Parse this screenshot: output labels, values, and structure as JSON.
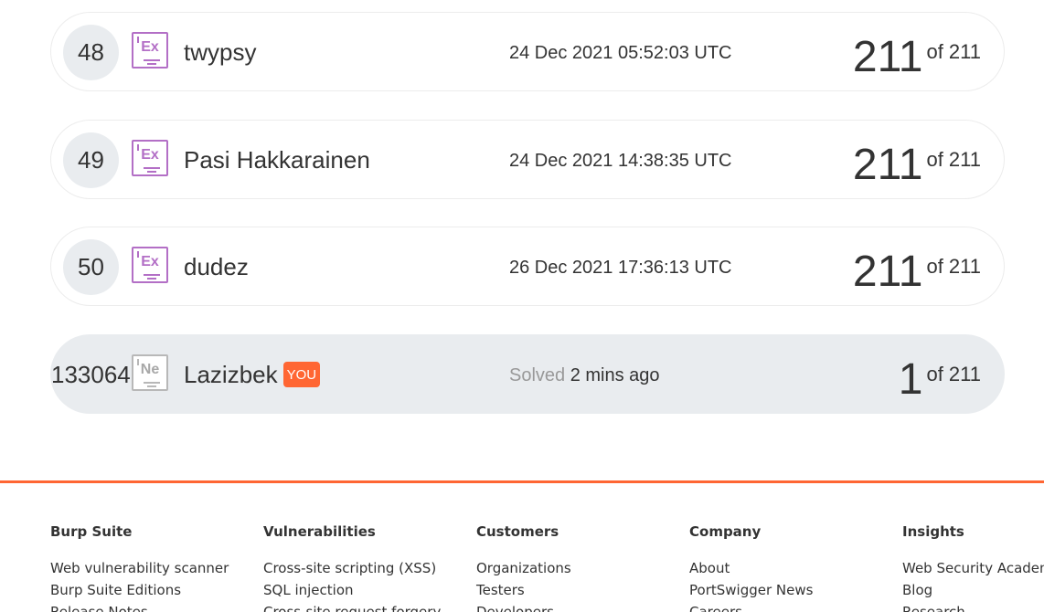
{
  "leaderboard": {
    "rows": [
      {
        "rank": "48",
        "badge": "Ex",
        "name": "twypsy",
        "date": "24 Dec 2021 05:52:03 UTC",
        "score": "211",
        "of": "of 211"
      },
      {
        "rank": "49",
        "badge": "Ex",
        "name": "Pasi Hakkarainen",
        "date": "24 Dec 2021 14:38:35 UTC",
        "score": "211",
        "of": "of 211"
      },
      {
        "rank": "50",
        "badge": "Ex",
        "name": "dudez",
        "date": "26 Dec 2021 17:36:13 UTC",
        "score": "211",
        "of": "of 211"
      }
    ],
    "current_user": {
      "rank": "133064",
      "badge": "Ne",
      "name": "Lazizbek",
      "you_tag": "YOU",
      "solved_label": "Solved",
      "solved_time": "2 mins ago",
      "score": "1",
      "of": "of 211"
    }
  },
  "footer": {
    "columns": [
      {
        "heading": "Burp Suite",
        "links": [
          "Web vulnerability scanner",
          "Burp Suite Editions",
          "Release Notes"
        ]
      },
      {
        "heading": "Vulnerabilities",
        "links": [
          "Cross-site scripting (XSS)",
          "SQL injection",
          "Cross-site request forgery"
        ]
      },
      {
        "heading": "Customers",
        "links": [
          "Organizations",
          "Testers",
          "Developers"
        ]
      },
      {
        "heading": "Company",
        "links": [
          "About",
          "PortSwigger News",
          "Careers"
        ]
      },
      {
        "heading": "Insights",
        "links": [
          "Web Security Academy",
          "Blog",
          "Research"
        ]
      }
    ]
  },
  "colors": {
    "accent": "#ff6633",
    "expert_badge": "#b36fc6",
    "novice_badge": "#b8b8b8",
    "highlight_row": "#e9ecef"
  }
}
